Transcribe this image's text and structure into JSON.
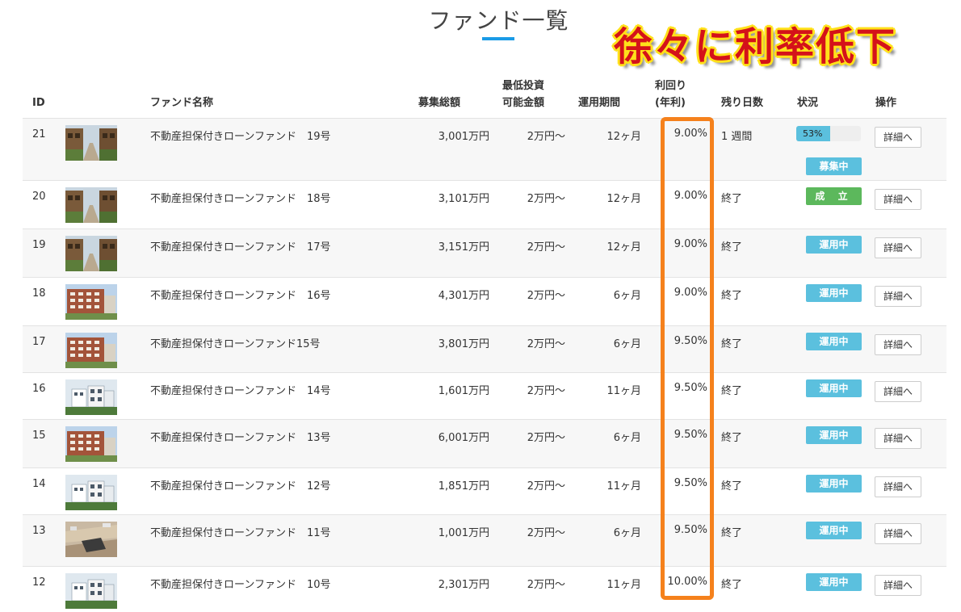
{
  "page": {
    "title": "ファンド一覧"
  },
  "annotation": "徐々に利率低下",
  "colors": {
    "accent_underline": "#1a9be6",
    "badge_blue": "#5bc0de",
    "badge_green": "#5cb85c",
    "highlight": "#f5811c",
    "annotation_text": "#d4121a",
    "annotation_outline": "#ffe11a"
  },
  "headers": {
    "id": "ID",
    "name": "ファンド名称",
    "total": "募集総額",
    "min_line1": "最低投資",
    "min_line2": "可能金額",
    "period": "運用期間",
    "rate_line1": "利回り",
    "rate_line2": "(年利)",
    "remaining": "残り日数",
    "status": "状況",
    "action": "操作"
  },
  "rows": [
    {
      "id": "21",
      "thumb": "street-photo",
      "name": "不動産担保付きローンファンド　19号",
      "total": "3,001万円",
      "min": "2万円～",
      "period": "12ヶ月",
      "rate": "9.00%",
      "remaining": "1 週間",
      "progress": "53%",
      "progress_value": 0.53,
      "status": "募集中",
      "status_color": "blue",
      "detail": "詳細へ"
    },
    {
      "id": "20",
      "thumb": "street-photo",
      "name": "不動産担保付きローンファンド　18号",
      "total": "3,101万円",
      "min": "2万円～",
      "period": "12ヶ月",
      "rate": "9.00%",
      "remaining": "終了",
      "status": "成 立",
      "status_color": "green",
      "detail": "詳細へ"
    },
    {
      "id": "19",
      "thumb": "street-photo",
      "name": "不動産担保付きローンファンド　17号",
      "total": "3,151万円",
      "min": "2万円～",
      "period": "12ヶ月",
      "rate": "9.00%",
      "remaining": "終了",
      "status": "運用中",
      "status_color": "blue",
      "detail": "詳細へ"
    },
    {
      "id": "18",
      "thumb": "apartment-photo",
      "name": "不動産担保付きローンファンド　16号",
      "total": "4,301万円",
      "min": "2万円～",
      "period": "6ヶ月",
      "rate": "9.00%",
      "remaining": "終了",
      "status": "運用中",
      "status_color": "blue",
      "detail": "詳細へ"
    },
    {
      "id": "17",
      "thumb": "apartment-photo",
      "name": "不動産担保付きローンファンド15号",
      "total": "3,801万円",
      "min": "2万円～",
      "period": "6ヶ月",
      "rate": "9.50%",
      "remaining": "終了",
      "status": "運用中",
      "status_color": "blue",
      "detail": "詳細へ"
    },
    {
      "id": "16",
      "thumb": "house-photo",
      "name": "不動産担保付きローンファンド　14号",
      "total": "1,601万円",
      "min": "2万円～",
      "period": "11ヶ月",
      "rate": "9.50%",
      "remaining": "終了",
      "status": "運用中",
      "status_color": "blue",
      "detail": "詳細へ"
    },
    {
      "id": "15",
      "thumb": "apartment-photo",
      "name": "不動産担保付きローンファンド　13号",
      "total": "6,001万円",
      "min": "2万円～",
      "period": "6ヶ月",
      "rate": "9.50%",
      "remaining": "終了",
      "status": "運用中",
      "status_color": "blue",
      "detail": "詳細へ"
    },
    {
      "id": "14",
      "thumb": "house-photo",
      "name": "不動産担保付きローンファンド　12号",
      "total": "1,851万円",
      "min": "2万円～",
      "period": "11ヶ月",
      "rate": "9.50%",
      "remaining": "終了",
      "status": "運用中",
      "status_color": "blue",
      "detail": "詳細へ"
    },
    {
      "id": "13",
      "thumb": "land-photo",
      "name": "不動産担保付きローンファンド　11号",
      "total": "1,001万円",
      "min": "2万円～",
      "period": "6ヶ月",
      "rate": "9.50%",
      "remaining": "終了",
      "status": "運用中",
      "status_color": "blue",
      "detail": "詳細へ"
    },
    {
      "id": "12",
      "thumb": "house-photo",
      "name": "不動産担保付きローンファンド　10号",
      "total": "2,301万円",
      "min": "2万円～",
      "period": "11ヶ月",
      "rate": "10.00%",
      "remaining": "終了",
      "status": "運用中",
      "status_color": "blue",
      "detail": "詳細へ"
    }
  ]
}
